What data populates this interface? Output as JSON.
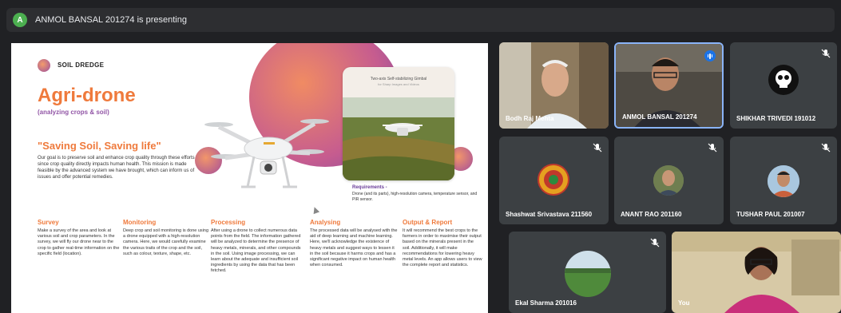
{
  "presenting": {
    "avatar_letter": "A",
    "text": "ANMOL BANSAL 201274 is presenting"
  },
  "slide": {
    "brand": "SOIL DREDGE",
    "title": "Agri-drone",
    "subtitle": "(analyzing crops & soil)",
    "quote": "\"Saving Soil, Saving life\"",
    "description": "Our goal is to preserve soil and enhance crop quality through these efforts since crop quality directly impacts human health. This mission is made feasible by the advanced system we have brought, which can inform us of issues and offer potential remedies.",
    "photo_caption": "Two-axis Self-stabilizing Gimbal",
    "photo_caption_2": "for Sharp Images and Videos",
    "requirements_title": "Requirements -",
    "requirements_text": "Drone (and its parts), high-resolution camera, temperature sensor, and PIR sensor.",
    "sections": [
      {
        "heading": "Survey",
        "text": "Make a survey of the area and look at various soil and crop parameters. In the survey, we will fly our drone near to the crop to gather real-time information on the specific field (location)."
      },
      {
        "heading": "Monitoring",
        "text": "Deep crop and soil monitoring is done using a drone equipped with a high-resolution camera. Here, we would carefully examine the various traits of the crop and the soil, such as colour, texture, shape, etc."
      },
      {
        "heading": "Processing",
        "text": "After using a drone to collect numerous data points from the field. The information gathered will be analyzed to determine the presence of heavy metals, minerals, and other compounds in the soil. Using image processing, we can learn about the adequate and insufficient soil ingredients by using the data that has been fetched."
      },
      {
        "heading": "Analysing",
        "text": "The processed data will be analysed with the aid of deep learning and machine learning. Here, we'll acknowledge the existence of heavy metals and suggest ways to lessen it in the soil because it harms crops and has a significant negative impact on human health when consumed."
      },
      {
        "heading": "Output & Report",
        "text": "It will recommend the best crops to the farmers in order to maximise their output based on the minerals present in the soil. Additionally, it will make recommendations for lowering heavy metal levels. An app allows users to view the complete report and statistics."
      }
    ]
  },
  "participants": [
    {
      "name": "Bodh Raj Mehta",
      "mic": "none"
    },
    {
      "name": "ANMOL BANSAL 201274",
      "mic": "speaking"
    },
    {
      "name": "SHIKHAR TRIVEDI 191012",
      "mic": "muted"
    },
    {
      "name": "Shashwat Srivastava 211560",
      "mic": "muted"
    },
    {
      "name": "ANANT RAO 201160",
      "mic": "muted"
    },
    {
      "name": "TUSHAR PAUL 201007",
      "mic": "muted"
    },
    {
      "name": "Ekal Sharma 201016",
      "mic": "muted"
    },
    {
      "name": "You",
      "mic": "none"
    }
  ],
  "colors": {
    "accent_orange": "#ef7a3c",
    "accent_purple": "#9256a6",
    "speaking_blue": "#1a73e8",
    "active_border": "#8ab4f8",
    "tile_bg": "#3c4043"
  },
  "icons": {
    "muted": "mic-off-icon",
    "speaking": "audio-level-icon"
  }
}
